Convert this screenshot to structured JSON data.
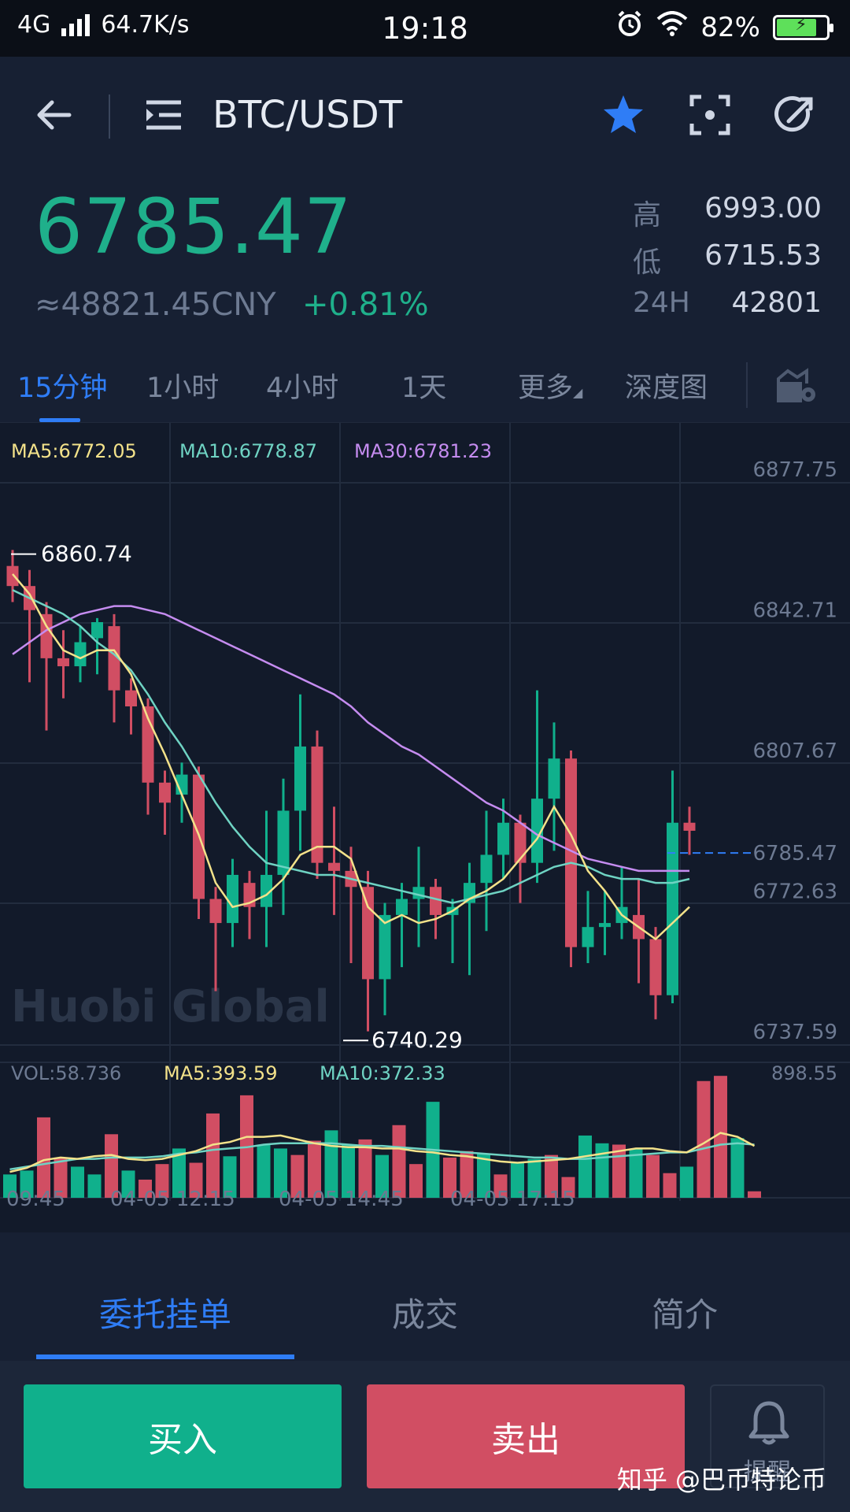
{
  "status_bar": {
    "network": "4G",
    "speed": "64.7K/s",
    "time": "19:18",
    "battery": "82%",
    "battery_level": 0.82
  },
  "header": {
    "title": "BTC/USDT",
    "back_icon": "back-arrow-icon",
    "menu_icon": "list-menu-icon",
    "favorite_icon": "star-icon",
    "screenshot_icon": "scan-icon",
    "share_icon": "share-icon"
  },
  "ticker": {
    "last_price": "6785.47",
    "cny_price": "≈48821.45CNY",
    "change": "+0.81%",
    "stats": [
      {
        "label": "高",
        "value": "6993.00"
      },
      {
        "label": "低",
        "value": "6715.53"
      },
      {
        "label": "24H",
        "value": "42801"
      }
    ]
  },
  "period_tabs": [
    {
      "label": "15分钟",
      "active": true
    },
    {
      "label": "1小时",
      "active": false
    },
    {
      "label": "4小时",
      "active": false
    },
    {
      "label": "1天",
      "active": false
    },
    {
      "label": "更多",
      "active": false
    },
    {
      "label": "深度图",
      "active": false
    }
  ],
  "chart_data": {
    "type": "candlestick",
    "indicators": {
      "ma5": "MA5:6772.05",
      "ma10": "MA10:6778.87",
      "ma30": "MA30:6781.23"
    },
    "y_ticks": [
      "6877.75",
      "6842.71",
      "6807.67",
      "6772.63",
      "6737.59"
    ],
    "y_tick_values": [
      6877.75,
      6842.71,
      6807.67,
      6772.63,
      6737.59
    ],
    "current_price_label": "6785.47",
    "current_price": 6785.47,
    "high_marker": "6860.74",
    "high_value": 6860.74,
    "low_marker": "6740.29",
    "low_value": 6740.29,
    "watermark": "Huobi Global",
    "x_labels": [
      "09:45",
      "04-05 12:15",
      "04-05 14:45",
      "04-05 17:15"
    ],
    "candles": [
      [
        6857,
        6852,
        6861,
        6848
      ],
      [
        6852,
        6846,
        6856,
        6828
      ],
      [
        6845,
        6834,
        6848,
        6816
      ],
      [
        6834,
        6832,
        6841,
        6824
      ],
      [
        6832,
        6838,
        6842,
        6828
      ],
      [
        6839,
        6843,
        6844,
        6830
      ],
      [
        6842,
        6826,
        6845,
        6818
      ],
      [
        6826,
        6822,
        6829,
        6815
      ],
      [
        6822,
        6803,
        6824,
        6795
      ],
      [
        6803,
        6798,
        6806,
        6790
      ],
      [
        6800,
        6805,
        6808,
        6793
      ],
      [
        6805,
        6774,
        6807,
        6769
      ],
      [
        6774,
        6768,
        6777,
        6751
      ],
      [
        6768,
        6780,
        6784,
        6762
      ],
      [
        6778,
        6772,
        6781,
        6764
      ],
      [
        6772,
        6780,
        6796,
        6762
      ],
      [
        6780,
        6796,
        6804,
        6770
      ],
      [
        6796,
        6812,
        6825,
        6786
      ],
      [
        6812,
        6783,
        6816,
        6779
      ],
      [
        6783,
        6781,
        6797,
        6770
      ],
      [
        6781,
        6777,
        6787,
        6758
      ],
      [
        6777,
        6754,
        6781,
        6741
      ],
      [
        6754,
        6770,
        6773,
        6745
      ],
      [
        6770,
        6774,
        6778,
        6757
      ],
      [
        6774,
        6777,
        6787,
        6762
      ],
      [
        6777,
        6770,
        6779,
        6764
      ],
      [
        6770,
        6772,
        6774,
        6758
      ],
      [
        6773,
        6778,
        6783,
        6755
      ],
      [
        6778,
        6785,
        6796,
        6766
      ],
      [
        6785,
        6793,
        6799,
        6779
      ],
      [
        6793,
        6783,
        6795,
        6773
      ],
      [
        6783,
        6799,
        6826,
        6778
      ],
      [
        6799,
        6809,
        6818,
        6786
      ],
      [
        6809,
        6762,
        6811,
        6757
      ],
      [
        6762,
        6767,
        6776,
        6758
      ],
      [
        6767,
        6768,
        6776,
        6760
      ],
      [
        6768,
        6772,
        6782,
        6764
      ],
      [
        6770,
        6764,
        6779,
        6753
      ],
      [
        6764,
        6750,
        6767,
        6744
      ],
      [
        6750,
        6793,
        6806,
        6748
      ],
      [
        6793,
        6791,
        6797,
        6785
      ]
    ],
    "ma5": [
      6855,
      6850,
      6842,
      6836,
      6834,
      6836,
      6836,
      6830,
      6819,
      6810,
      6800,
      6790,
      6778,
      6772,
      6773,
      6775,
      6779,
      6785,
      6787,
      6787,
      6784,
      6772,
      6768,
      6770,
      6768,
      6769,
      6771,
      6774,
      6776,
      6779,
      6784,
      6789,
      6797,
      6790,
      6781,
      6776,
      6770,
      6767,
      6764,
      6768,
      6772
    ],
    "ma10": [
      6851,
      6849,
      6847,
      6845,
      6842,
      6838,
      6835,
      6831,
      6825,
      6818,
      6812,
      6805,
      6798,
      6792,
      6787,
      6783,
      6782,
      6781,
      6780,
      6780,
      6779,
      6778,
      6777,
      6776,
      6775,
      6774,
      6773,
      6774,
      6775,
      6776,
      6778,
      6780,
      6782,
      6783,
      6782,
      6780,
      6779,
      6779,
      6778,
      6778,
      6779
    ],
    "ma30": [
      6835,
      6838,
      6841,
      6843,
      6845,
      6846,
      6847,
      6847,
      6846,
      6845,
      6843,
      6841,
      6839,
      6837,
      6835,
      6833,
      6831,
      6829,
      6827,
      6825,
      6822,
      6818,
      6815,
      6812,
      6810,
      6807,
      6804,
      6801,
      6798,
      6796,
      6793,
      6790,
      6788,
      6786,
      6784,
      6783,
      6782,
      6781,
      6781,
      6781,
      6781
    ],
    "volume": {
      "vol_label": "VOL:58.736",
      "ma5_label": "MA5:393.59",
      "ma10_label": "MA10:372.33",
      "y_max_label": "898.55",
      "y_max": 898.55,
      "bars": [
        180,
        210,
        620,
        310,
        240,
        180,
        490,
        210,
        140,
        260,
        380,
        270,
        650,
        320,
        790,
        410,
        380,
        330,
        440,
        520,
        410,
        450,
        330,
        560,
        260,
        740,
        310,
        360,
        340,
        180,
        270,
        300,
        330,
        160,
        480,
        420,
        410,
        380,
        330,
        190,
        240,
        900,
        940,
        460,
        50
      ],
      "ma5": [
        200,
        230,
        290,
        310,
        300,
        320,
        330,
        300,
        290,
        300,
        330,
        360,
        410,
        430,
        470,
        470,
        480,
        450,
        420,
        400,
        390,
        390,
        380,
        380,
        360,
        350,
        330,
        320,
        300,
        280,
        270,
        280,
        290,
        300,
        320,
        340,
        360,
        380,
        380,
        360,
        350,
        420,
        500,
        470,
        400
      ],
      "ma10": [
        220,
        240,
        260,
        280,
        300,
        300,
        310,
        310,
        310,
        320,
        340,
        350,
        370,
        380,
        390,
        410,
        420,
        420,
        420,
        420,
        410,
        400,
        400,
        390,
        380,
        370,
        360,
        350,
        340,
        330,
        320,
        310,
        310,
        300,
        300,
        310,
        320,
        330,
        340,
        350,
        350,
        380,
        410,
        420,
        410
      ]
    }
  },
  "bottom_tabs": [
    {
      "label": "委托挂单",
      "active": true
    },
    {
      "label": "成交",
      "active": false
    },
    {
      "label": "简介",
      "active": false
    }
  ],
  "actions": {
    "buy": "买入",
    "sell": "卖出",
    "alert": "提醒",
    "alert_icon": "bell-icon"
  },
  "watermark": "知乎 @巴币特论币",
  "colors": {
    "up": "#10b08c",
    "down": "#d14e63",
    "ma5": "#f3e28a",
    "ma10": "#6fd3c3",
    "ma30": "#c58cf0",
    "accent": "#2f7df6"
  }
}
